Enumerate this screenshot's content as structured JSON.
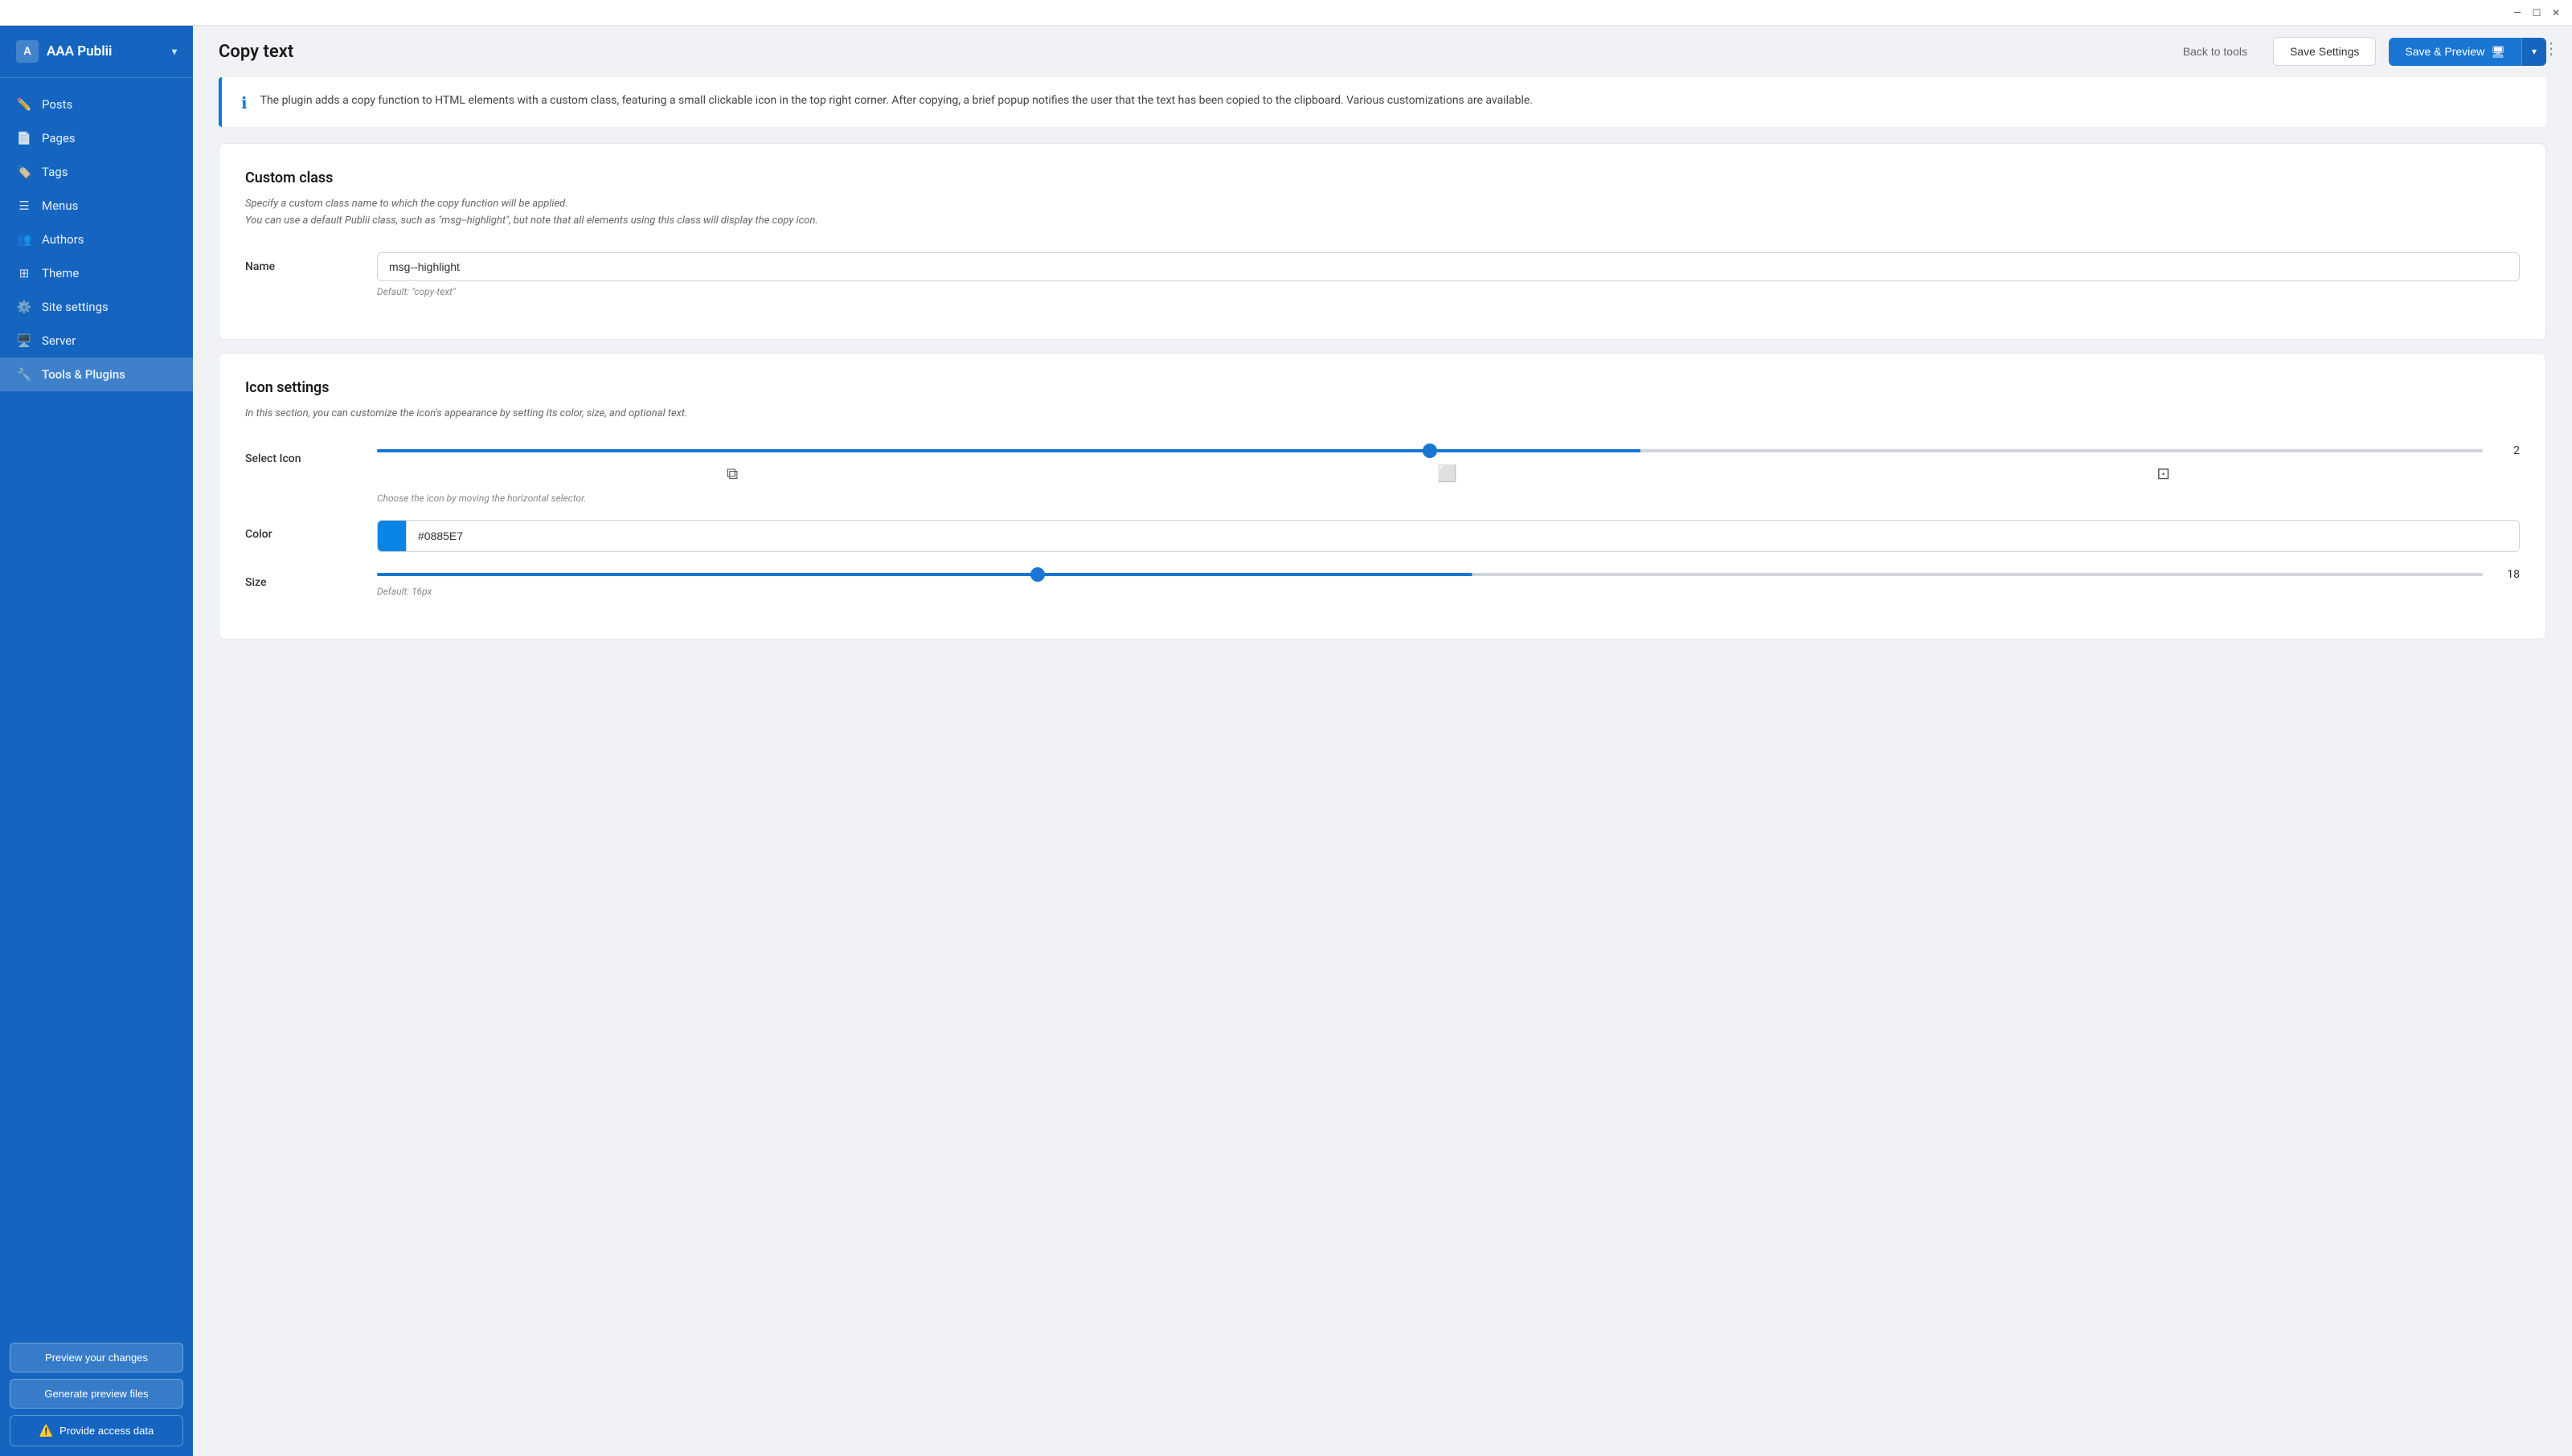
{
  "titlebar": {
    "minimize": "—",
    "maximize": "☐",
    "close": "✕"
  },
  "sidebar": {
    "brand": "AAA Publii",
    "brand_chevron": "▾",
    "items": [
      {
        "id": "posts",
        "label": "Posts",
        "icon": "✏"
      },
      {
        "id": "pages",
        "label": "Pages",
        "icon": "📄"
      },
      {
        "id": "tags",
        "label": "Tags",
        "icon": "🏷"
      },
      {
        "id": "menus",
        "label": "Menus",
        "icon": "☰"
      },
      {
        "id": "authors",
        "label": "Authors",
        "icon": "👥"
      },
      {
        "id": "theme",
        "label": "Theme",
        "icon": "⊞"
      },
      {
        "id": "site-settings",
        "label": "Site settings",
        "icon": "⚙"
      },
      {
        "id": "server",
        "label": "Server",
        "icon": "🖥"
      },
      {
        "id": "tools-plugins",
        "label": "Tools & Plugins",
        "icon": "🔧"
      }
    ],
    "bottom_buttons": [
      {
        "id": "preview-changes",
        "label": "Preview your changes"
      },
      {
        "id": "generate-preview",
        "label": "Generate preview files"
      }
    ],
    "warning_btn": "Provide access data"
  },
  "header": {
    "page_title": "Copy text",
    "back_label": "Back to tools",
    "save_settings_label": "Save Settings",
    "save_preview_label": "Save & Preview",
    "save_preview_icon": "🖥",
    "dropdown_arrow": "▾",
    "more_icon": "⋮"
  },
  "info_banner": {
    "icon": "ℹ",
    "text": "The plugin adds a copy function to HTML elements with a custom class, featuring a small clickable icon in the top right corner. After copying, a brief popup notifies the user that the text has been copied to the clipboard. Various customizations are available."
  },
  "custom_class": {
    "section_title": "Custom class",
    "description_line1": "Specify a custom class name to which the copy function will be applied.",
    "description_line2": "You can use a default Publii class, such as \"msg--highlight\", but note that all elements using this class will display the copy icon.",
    "name_label": "Name",
    "name_value": "msg--highlight",
    "name_hint": "Default: \"copy-text\""
  },
  "icon_settings": {
    "section_title": "Icon settings",
    "description": "In this section, you can customize the icon's appearance by setting its color, size, and optional text.",
    "select_icon_label": "Select Icon",
    "slider_value": 2,
    "slider_min": 1,
    "slider_max": 3,
    "slider_position_pct": 50,
    "icon_1": "⧉",
    "icon_2": "⬜",
    "icon_3": "⊡",
    "icon_hint": "Choose the icon by moving the horizontal selector.",
    "color_label": "Color",
    "color_value": "#0885E7",
    "size_label": "Size",
    "size_value": 18,
    "size_min": 8,
    "size_max": 40,
    "size_position_pct": 52,
    "size_hint": "Default: 16px"
  }
}
